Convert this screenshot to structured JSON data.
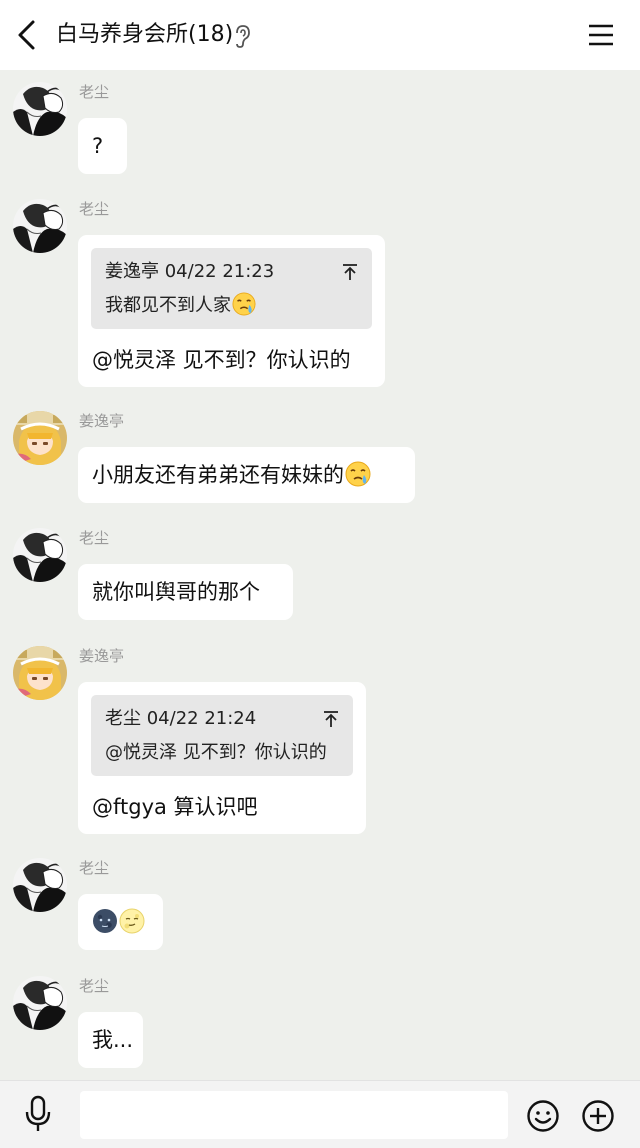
{
  "header": {
    "title": "白马养身会所(18)"
  },
  "messages": [
    {
      "sender": "老尘",
      "avatar": "monochrome-avatar",
      "text": "?"
    },
    {
      "sender": "老尘",
      "avatar": "monochrome-avatar",
      "quote": {
        "author_time": "姜逸亭 04/22 21:23",
        "text": "我都见不到人家",
        "emoji": "crying-face"
      },
      "text": "@悦灵泽 见不到？你认识的"
    },
    {
      "sender": "姜逸亭",
      "avatar": "anime-avatar",
      "text": "小朋友还有弟弟还有妹妹的",
      "emoji": "crying-face"
    },
    {
      "sender": "老尘",
      "avatar": "monochrome-avatar",
      "text": "就你叫舆哥的那个"
    },
    {
      "sender": "姜逸亭",
      "avatar": "anime-avatar",
      "quote": {
        "author_time": "老尘 04/22 21:24",
        "text": "@悦灵泽 见不到？你认识的"
      },
      "text": "@ftgya 算认识吧"
    },
    {
      "sender": "老尘",
      "avatar": "monochrome-avatar",
      "emojis": [
        "new-moon-face",
        "full-moon-face"
      ]
    },
    {
      "sender": "老尘",
      "avatar": "monochrome-avatar",
      "text": "我..."
    }
  ],
  "input": {
    "placeholder": ""
  },
  "icons": {
    "back": "chevron-left-icon",
    "ear": "ear-icon",
    "menu": "hamburger-menu-icon",
    "pin": "pin-to-top-icon",
    "mic": "microphone-icon",
    "emoji": "smiley-icon",
    "plus": "plus-circle-icon"
  },
  "colors": {
    "background": "#eef0ec",
    "bubble": "#ffffff",
    "quote": "#e7e7e7",
    "name": "#999999"
  }
}
